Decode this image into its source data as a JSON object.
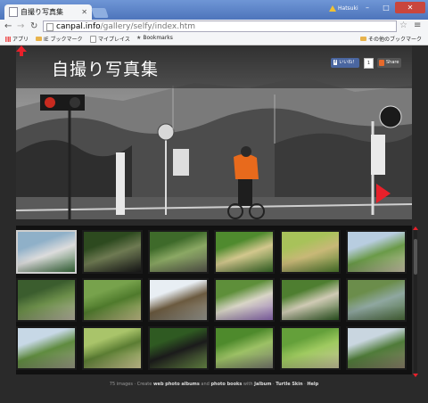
{
  "browser": {
    "tab_title": "自撮り写真集",
    "user_name": "Hatsuki",
    "url_host": "canpal.info",
    "url_path": "/gallery/selfy/index.htm",
    "bookmarks": [
      "アプリ",
      "IE ブックマーク",
      "マイプレイス",
      "Bookmarks"
    ],
    "other_bookmarks": "その他のブックマーク"
  },
  "page": {
    "title": "自撮り写真集",
    "like_label": "いいね！",
    "like_count": "1",
    "share_label": "Share"
  },
  "gallery": {
    "thumbnails": [
      {
        "name": "thumb-01",
        "colors": [
          "#8fb0c8",
          "#dcdcdc",
          "#3b6f3e"
        ],
        "selected": true
      },
      {
        "name": "thumb-02",
        "colors": [
          "#2d4a1f",
          "#6e7a52",
          "#1a1a1a"
        ],
        "selected": false
      },
      {
        "name": "thumb-03",
        "colors": [
          "#3e6a2a",
          "#8ba864",
          "#5b5b4f"
        ],
        "selected": false
      },
      {
        "name": "thumb-04",
        "colors": [
          "#4f8a2e",
          "#d2c78d",
          "#3a6d28"
        ],
        "selected": false
      },
      {
        "name": "thumb-05",
        "colors": [
          "#a8c25a",
          "#c8b877",
          "#4f7d2e"
        ],
        "selected": false
      },
      {
        "name": "thumb-06",
        "colors": [
          "#b8cde0",
          "#6a9a48",
          "#c9c2a8"
        ],
        "selected": false
      },
      {
        "name": "thumb-07",
        "colors": [
          "#3b5d2e",
          "#6c8e4a",
          "#b9b5a3"
        ],
        "selected": false
      },
      {
        "name": "thumb-08",
        "colors": [
          "#77a24c",
          "#4f7a2c",
          "#c6c08a"
        ],
        "selected": false
      },
      {
        "name": "thumb-09",
        "colors": [
          "#e8eef3",
          "#6b5a3f",
          "#9c9c94"
        ],
        "selected": false
      },
      {
        "name": "thumb-10",
        "colors": [
          "#5e8f3a",
          "#d8d5c6",
          "#8f6bb8"
        ],
        "selected": false
      },
      {
        "name": "thumb-11",
        "colors": [
          "#4e7e30",
          "#cfcab4",
          "#2e5a22"
        ],
        "selected": false
      },
      {
        "name": "thumb-12",
        "colors": [
          "#6b8d4b",
          "#8fa7a0",
          "#4b6b3a"
        ],
        "selected": false
      },
      {
        "name": "thumb-13",
        "colors": [
          "#c7d8e6",
          "#5f8b3f",
          "#9a9a86"
        ],
        "selected": false
      },
      {
        "name": "thumb-14",
        "colors": [
          "#a9c46a",
          "#5b7d33",
          "#d6cf9a"
        ],
        "selected": false
      },
      {
        "name": "thumb-15",
        "colors": [
          "#2f5a22",
          "#1b1b1b",
          "#6d8f4a"
        ],
        "selected": false
      },
      {
        "name": "thumb-16",
        "colors": [
          "#4e8a2c",
          "#9cc165",
          "#7a7a70"
        ],
        "selected": false
      },
      {
        "name": "thumb-17",
        "colors": [
          "#64a03a",
          "#9fca60",
          "#c7c29c"
        ],
        "selected": false
      },
      {
        "name": "thumb-18",
        "colors": [
          "#c9d6e0",
          "#4f7b39",
          "#8a7f6a"
        ],
        "selected": false
      }
    ]
  },
  "footer": {
    "images": "75 images",
    "create_text": "Create",
    "link1": "web photo albums",
    "and_text": "and",
    "link2": "photo books",
    "with_text": "with",
    "link3": "Jalbum",
    "link4": "Turtle Skin",
    "link5": "Help"
  }
}
